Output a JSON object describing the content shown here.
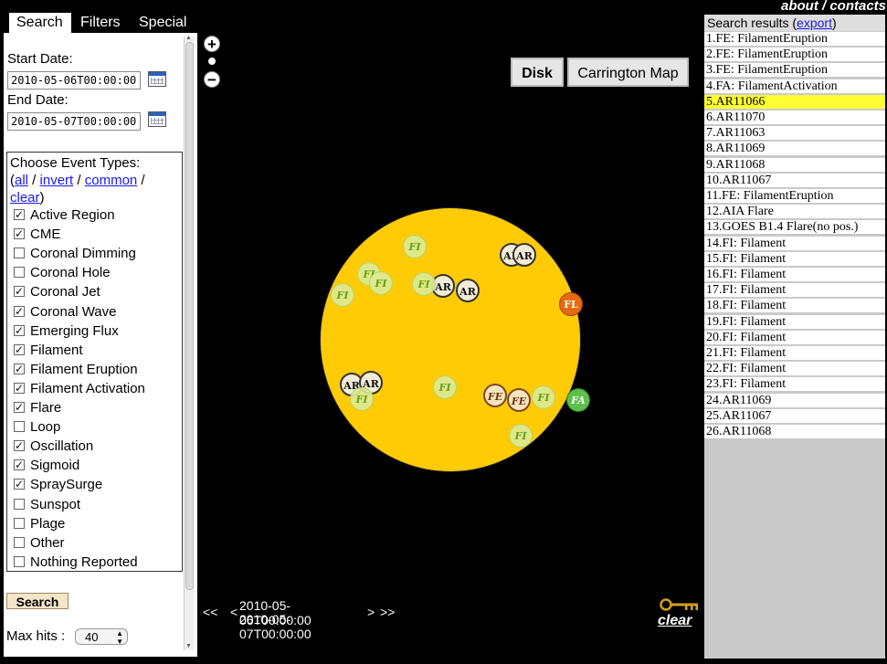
{
  "tabs": [
    "Search",
    "Filters",
    "Special"
  ],
  "header_link": "about / contacts",
  "search": {
    "start_label": "Start Date:",
    "start_value": "2010-05-06T00:00:00",
    "end_label": "End Date:",
    "end_value": "2010-05-07T00:00:00",
    "choose_label": "Choose Event Types:",
    "links": {
      "all": "all",
      "invert": "invert",
      "common": "common",
      "clear": "clear"
    },
    "events": [
      {
        "label": "Active Region",
        "checked": true
      },
      {
        "label": "CME",
        "checked": true
      },
      {
        "label": "Coronal Dimming",
        "checked": false
      },
      {
        "label": "Coronal Hole",
        "checked": false
      },
      {
        "label": "Coronal Jet",
        "checked": true
      },
      {
        "label": "Coronal Wave",
        "checked": true
      },
      {
        "label": "Emerging Flux",
        "checked": true
      },
      {
        "label": "Filament",
        "checked": true
      },
      {
        "label": "Filament Eruption",
        "checked": true
      },
      {
        "label": "Filament Activation",
        "checked": true
      },
      {
        "label": "Flare",
        "checked": true
      },
      {
        "label": "Loop",
        "checked": false
      },
      {
        "label": "Oscillation",
        "checked": true
      },
      {
        "label": "Sigmoid",
        "checked": true
      },
      {
        "label": "SpraySurge",
        "checked": true
      },
      {
        "label": "Sunspot",
        "checked": false
      },
      {
        "label": "Plage",
        "checked": false
      },
      {
        "label": "Other",
        "checked": false
      },
      {
        "label": "Nothing Reported",
        "checked": false
      }
    ],
    "search_button": "Search",
    "max_hits_label": "Max hits :",
    "max_hits_value": "40"
  },
  "map": {
    "zoom_in": "+",
    "zoom_out": "−",
    "view_disk": "Disk",
    "view_carrington": "Carrington Map",
    "time_prev": "<<",
    "time_lt": "<",
    "time_start": "2010-05-06T00:00:00",
    "time_end": "2010-05-07T00:00:00",
    "time_gt": ">",
    "time_next": ">>",
    "clear_label": "clear",
    "colors": {
      "sun": "#ffcb05",
      "background": "#000000",
      "selected_row": "#ffff33"
    }
  },
  "markers": [
    {
      "label": "FI",
      "kind": "fi"
    },
    {
      "label": "AR",
      "kind": "ar"
    },
    {
      "label": "AR",
      "kind": "ar"
    },
    {
      "label": "FI",
      "kind": "fi"
    },
    {
      "label": "FI",
      "kind": "fi"
    },
    {
      "label": "FI",
      "kind": "fi"
    },
    {
      "label": "AR",
      "kind": "ar"
    },
    {
      "label": "AR",
      "kind": "ar"
    },
    {
      "label": "FI",
      "kind": "fi"
    },
    {
      "label": "FL",
      "kind": "fl"
    },
    {
      "label": "AR",
      "kind": "ar"
    },
    {
      "label": "AR",
      "kind": "ar"
    },
    {
      "label": "FI",
      "kind": "fi"
    },
    {
      "label": "FI",
      "kind": "fi"
    },
    {
      "label": "FE",
      "kind": "fe"
    },
    {
      "label": "FE",
      "kind": "fe"
    },
    {
      "label": "FI",
      "kind": "fi"
    },
    {
      "label": "FA",
      "kind": "fa"
    },
    {
      "label": "FI",
      "kind": "fi"
    }
  ],
  "results": {
    "title": "Search results (",
    "export": "export",
    "close": ")",
    "items": [
      "1.FE: FilamentEruption",
      "2.FE: FilamentEruption",
      "3.FE: FilamentEruption",
      "4.FA: FilamentActivation",
      "5.AR11066",
      "6.AR11070",
      "7.AR11063",
      "8.AR11069",
      "9.AR11068",
      "10.AR11067",
      "11.FE: FilamentEruption",
      "12.AIA Flare",
      "13.GOES B1.4 Flare(no pos.)",
      "14.FI: Filament",
      "15.FI: Filament",
      "16.FI: Filament",
      "17.FI: Filament",
      "18.FI: Filament",
      "19.FI: Filament",
      "20.FI: Filament",
      "21.FI: Filament",
      "22.FI: Filament",
      "23.FI: Filament",
      "24.AR11069",
      "25.AR11067",
      "26.AR11068"
    ],
    "selected_index": 4
  }
}
